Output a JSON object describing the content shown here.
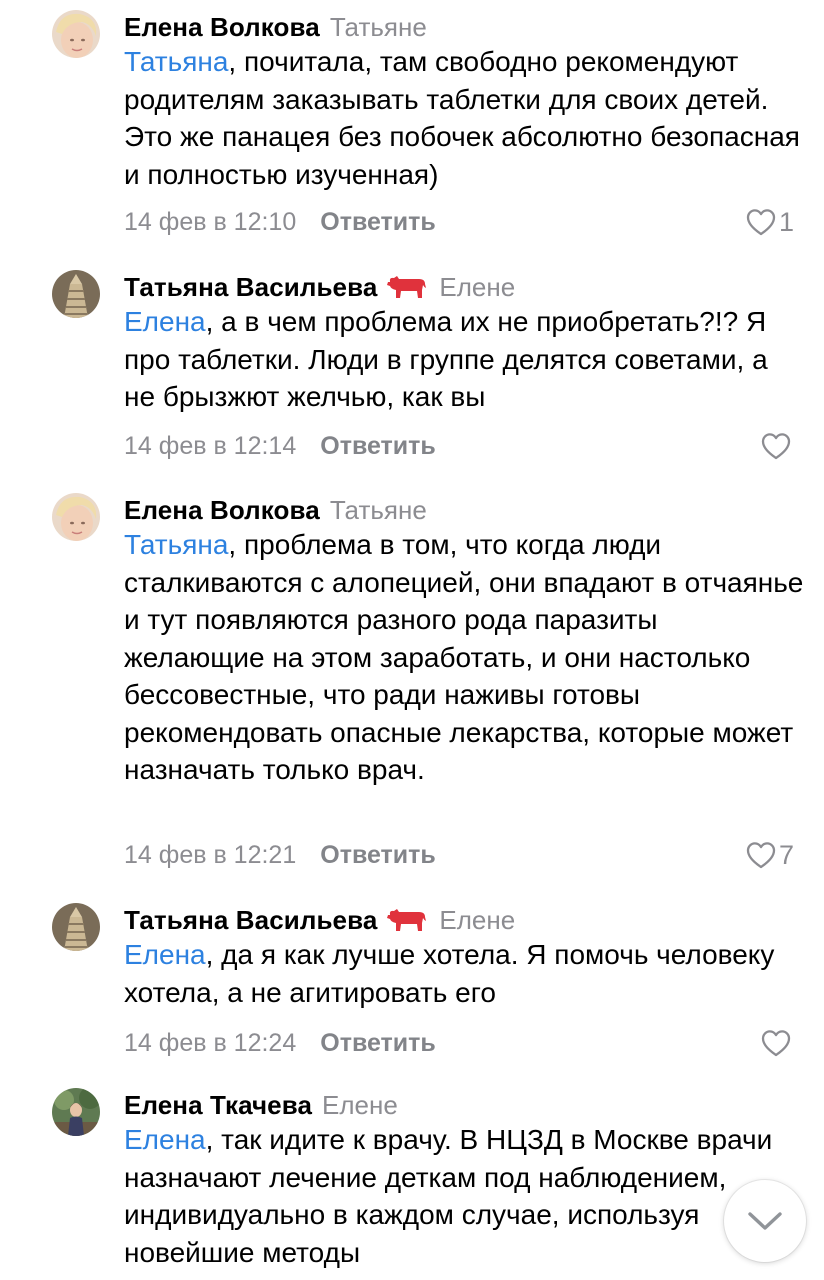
{
  "comments": [
    {
      "author": "Елена Волкова",
      "reply_to": "Татьяне",
      "mention": "Татьяна",
      "text": ", почитала, там свободно рекомендуют родителям заказывать таблетки для своих детей. Это же панацея без побочек абсолютно безопасная и полностью изученная)",
      "time": "14 фев в 12:10",
      "reply_label": "Ответить",
      "likes": "1"
    },
    {
      "author": "Татьяна Васильева",
      "reply_to": "Елене",
      "mention": "Елена",
      "text": ", а в чем проблема их не приобретать?!? Я про таблетки. Люди в группе делятся советами, а не брызжют желчью, как вы",
      "time": "14 фев в 12:14",
      "reply_label": "Ответить",
      "likes": ""
    },
    {
      "author": "Елена Волкова",
      "reply_to": "Татьяне",
      "mention": "Татьяна",
      "text": ", проблема в том, что когда люди сталкиваются с алопецией, они впадают в отчаянье и тут появляются разного рода паразиты желающие на этом заработать, и они настолько бессовестные, что ради наживы готовы рекомендовать опасные лекарства, которые может назначать только врач.",
      "time": "14 фев в 12:21",
      "reply_label": "Ответить",
      "likes": "7"
    },
    {
      "author": "Татьяна Васильева",
      "reply_to": "Елене",
      "mention": "Елена",
      "text": ", да я как лучше хотела. Я помочь человеку хотела, а не агитировать его",
      "time": "14 фев в 12:24",
      "reply_label": "Ответить",
      "likes": ""
    },
    {
      "author": "Елена Ткачева",
      "reply_to": "Елене",
      "mention": "Елена",
      "text": ", так идите к врачу. В НЦЗД в Москве врачи назначают лечение деткам под наблюдением, индивидуально в каждом случае, используя новейшие методы",
      "time": "",
      "reply_label": "",
      "likes": ""
    }
  ],
  "icons": {
    "like": "heart-outline-icon",
    "badge": "red-cow-icon",
    "scroll": "chevron-down-icon"
  },
  "colors": {
    "mention": "#2d81e0",
    "secondary": "#8c8c91",
    "badge": "#e0323c"
  }
}
